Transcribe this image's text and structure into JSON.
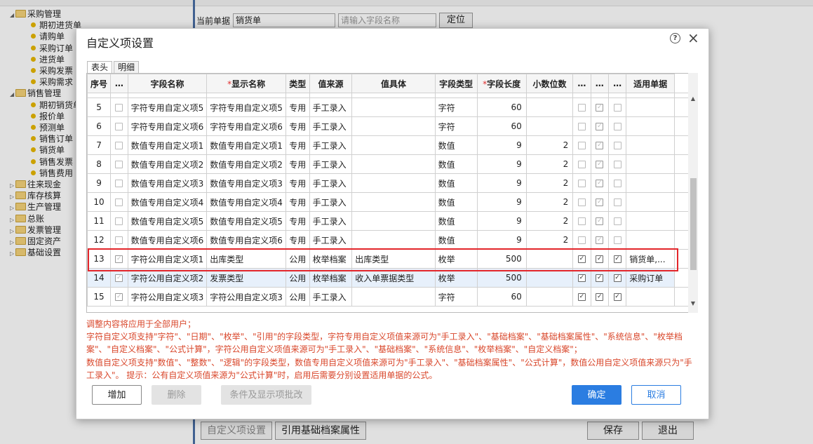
{
  "tree": {
    "purchase": {
      "label": "采购管理",
      "children": [
        "期初进货单",
        "请购单",
        "采购订单",
        "进货单",
        "采购发票",
        "采购需求"
      ]
    },
    "sales": {
      "label": "销售管理",
      "children": [
        "期初销货单",
        "报价单",
        "预测单",
        "销售订单",
        "销货单",
        "销售发票",
        "销售费用"
      ]
    },
    "others": [
      "往来现金",
      "库存核算",
      "生产管理",
      "总账",
      "发票管理",
      "固定资产",
      "基础设置"
    ]
  },
  "filter": {
    "label": "当前单据",
    "value": "销货单",
    "placeholder": "请输入字段名称",
    "locate": "定位"
  },
  "bottom_buttons": {
    "custom": "自定义项设置",
    "ref": "引用基础档案属性",
    "save": "保存",
    "exit": "退出"
  },
  "dialog": {
    "title": "自定义项设置",
    "help": "?",
    "close": "×",
    "tabs": [
      "表头",
      "明细"
    ],
    "columns": [
      "序号",
      "…",
      "字段名称",
      "显示名称",
      "类型",
      "值来源",
      "值具体",
      "字段类型",
      "字段长度",
      "小数位数",
      "…",
      "…",
      "…",
      "适用单据"
    ],
    "rows": [
      {
        "no": "5",
        "field": "字符专用自定义项5",
        "display": "字符专用自定义项5",
        "type": "专用",
        "src": "手工录入",
        "val": "",
        "ftype": "字符",
        "len": "60",
        "dec": ""
      },
      {
        "no": "6",
        "field": "字符专用自定义项6",
        "display": "字符专用自定义项6",
        "type": "专用",
        "src": "手工录入",
        "val": "",
        "ftype": "字符",
        "len": "60",
        "dec": ""
      },
      {
        "no": "7",
        "field": "数值专用自定义项1",
        "display": "数值专用自定义项1",
        "type": "专用",
        "src": "手工录入",
        "val": "",
        "ftype": "数值",
        "len": "9",
        "dec": "2"
      },
      {
        "no": "8",
        "field": "数值专用自定义项2",
        "display": "数值专用自定义项2",
        "type": "专用",
        "src": "手工录入",
        "val": "",
        "ftype": "数值",
        "len": "9",
        "dec": "2"
      },
      {
        "no": "9",
        "field": "数值专用自定义项3",
        "display": "数值专用自定义项3",
        "type": "专用",
        "src": "手工录入",
        "val": "",
        "ftype": "数值",
        "len": "9",
        "dec": "2"
      },
      {
        "no": "10",
        "field": "数值专用自定义项4",
        "display": "数值专用自定义项4",
        "type": "专用",
        "src": "手工录入",
        "val": "",
        "ftype": "数值",
        "len": "9",
        "dec": "2"
      },
      {
        "no": "11",
        "field": "数值专用自定义项5",
        "display": "数值专用自定义项5",
        "type": "专用",
        "src": "手工录入",
        "val": "",
        "ftype": "数值",
        "len": "9",
        "dec": "2"
      },
      {
        "no": "12",
        "field": "数值专用自定义项6",
        "display": "数值专用自定义项6",
        "type": "专用",
        "src": "手工录入",
        "val": "",
        "ftype": "数值",
        "len": "9",
        "dec": "2"
      },
      {
        "no": "13",
        "field": "字符公用自定义项1",
        "display": "出库类型",
        "type": "公用",
        "src": "枚举档案",
        "val": "出库类型",
        "ftype": "枚举",
        "len": "500",
        "dec": "",
        "apply": "销货单,..."
      },
      {
        "no": "14",
        "field": "字符公用自定义项2",
        "display": "发票类型",
        "type": "公用",
        "src": "枚举档案",
        "val": "收入单票据类型",
        "ftype": "枚举",
        "len": "500",
        "dec": "",
        "apply": "采购订单"
      },
      {
        "no": "15",
        "field": "字符公用自定义项3",
        "display": "字符公用自定义项3",
        "type": "公用",
        "src": "手工录入",
        "val": "",
        "ftype": "字符",
        "len": "60",
        "dec": ""
      }
    ],
    "notes": [
      "调整内容将应用于全部用户；",
      "字符自定义项支持\"字符\"、\"日期\"、\"枚举\"、\"引用\"的字段类型，字符专用自定义项值来源可为\"手工录入\"、\"基础档案\"、\"基础档案属性\"、\"系统信息\"、\"枚举档案\"、\"自定义档案\"、\"公式计算\"，字符公用自定义项值来源可为\"手工录入\"、\"基础档案\"、\"系统信息\"、\"枚举档案\"、\"自定义档案\"；",
      "数值自定义项支持\"数值\"、\"整数\"、\"逻辑\"的字段类型，数值专用自定义项值来源可为\"手工录入\"、\"基础档案属性\"、\"公式计算\"，数值公用自定义项值来源只为\"手工录入\"。 提示：公有自定义项值来源为\"公式计算\"时，启用后需要分别设置适用单据的公式。"
    ],
    "buttons": {
      "add": "增加",
      "delete": "删除",
      "batch": "条件及显示项批改",
      "ok": "确定",
      "cancel": "取消"
    },
    "accent_color": "#2b7de1",
    "highlight_color": "#e3252a"
  }
}
